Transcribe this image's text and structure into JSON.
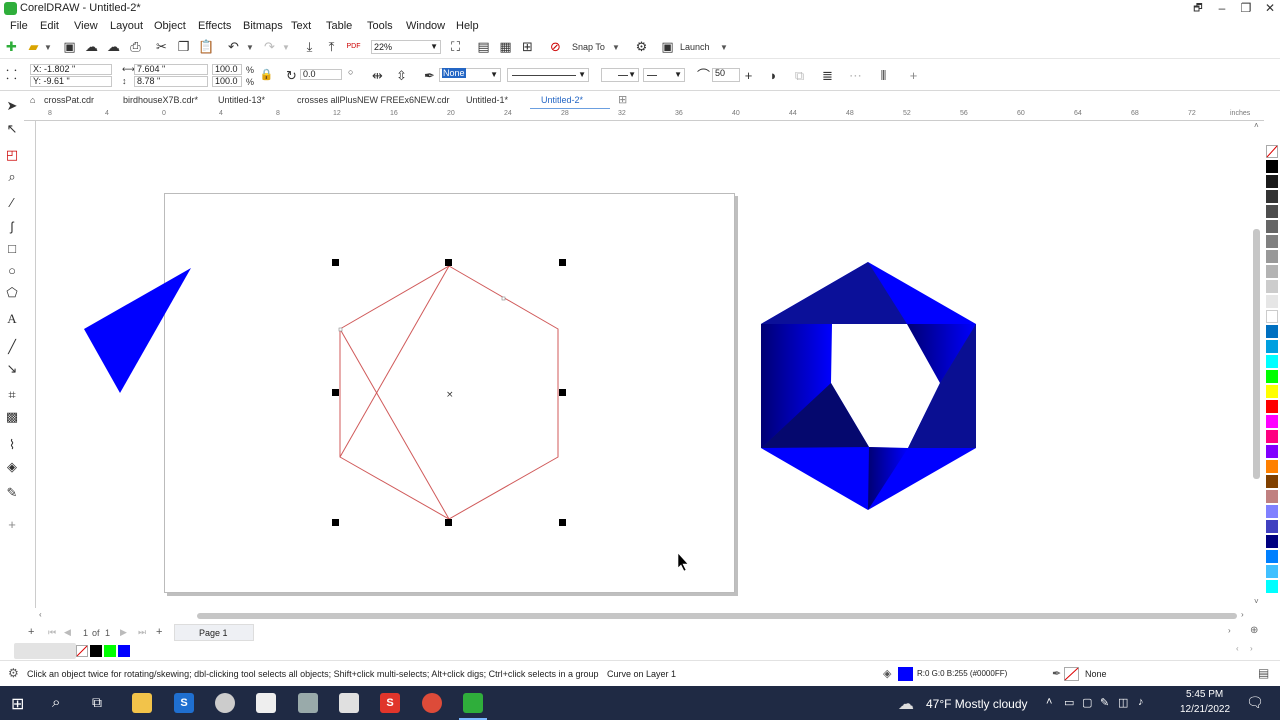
{
  "window": {
    "title": "CorelDRAW - Untitled-2*",
    "minimize": "–",
    "maximize": "❐",
    "close": "✕",
    "restore_icon": "🗗"
  },
  "menu": [
    "File",
    "Edit",
    "View",
    "Layout",
    "Object",
    "Effects",
    "Bitmaps",
    "Text",
    "Table",
    "Tools",
    "Window",
    "Help"
  ],
  "standard_toolbar": {
    "zoom": "22%",
    "snap_to": "Snap To",
    "launch": "Launch"
  },
  "property_bar": {
    "x": "X: -1.802 \"",
    "y": "Y: -9.61 \"",
    "width": "7.604 \"",
    "height": "8.78 \"",
    "scale_w": "100.0",
    "scale_h": "100.0",
    "percent": "%",
    "rotation": "0.0",
    "outline_width": "None",
    "smoothing": "50"
  },
  "tabs": [
    {
      "label": "crossPat.cdr",
      "active": false
    },
    {
      "label": "birdhouseX7B.cdr*",
      "active": false
    },
    {
      "label": "Untitled-13*",
      "active": false
    },
    {
      "label": "crosses allPlusNEW FREEx6NEW.cdr",
      "active": false
    },
    {
      "label": "Untitled-1*",
      "active": false
    },
    {
      "label": "Untitled-2*",
      "active": true
    }
  ],
  "ruler": {
    "h_ticks": [
      "8",
      "4",
      "0",
      "4",
      "8",
      "12",
      "16",
      "20",
      "24",
      "28",
      "32",
      "36",
      "40",
      "44",
      "48",
      "52",
      "56",
      "60",
      "64",
      "68",
      "72"
    ],
    "units": "inches"
  },
  "page_nav": {
    "current": "1",
    "of": "of",
    "total": "1",
    "page_tab": "Page 1"
  },
  "status": {
    "hint": "Click an object twice for rotating/skewing; dbl-clicking tool selects all objects; Shift+click multi-selects; Alt+click digs; Ctrl+click selects in a group",
    "object_info": "Curve on Layer 1",
    "fill_info": "R:0 G:0 B:255 (#0000FF)",
    "outline_info": "None"
  },
  "taskbar": {
    "weather": "47°F  Mostly cloudy",
    "time": "5:45 PM",
    "date": "12/21/2022"
  },
  "colors": {
    "fill_blue": "#0000ff",
    "dark_blue": "#060a8a",
    "outline_red": "#d05a5a",
    "accent": "#2466c4"
  },
  "palette": [
    "#000000",
    "#1a1a1a",
    "#333333",
    "#4d4d4d",
    "#666666",
    "#808080",
    "#999999",
    "#b3b3b3",
    "#cccccc",
    "#e6e6e6",
    "#ffffff",
    "#0070c0",
    "#00a0e0",
    "#00ffff",
    "#00ff00",
    "#ffff00",
    "#ff0000",
    "#ff00ff",
    "#ff0080",
    "#8000ff",
    "#ff8000",
    "#804000",
    "#c08080",
    "#8080ff",
    "#4040c0",
    "#000080",
    "#0080ff",
    "#40c0ff",
    "#00ffff"
  ]
}
